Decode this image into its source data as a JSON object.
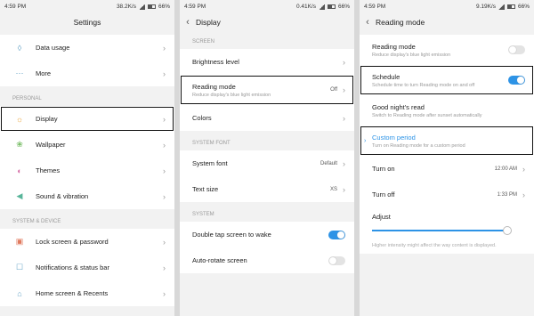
{
  "p1": {
    "time": "4:59 PM",
    "net": "38.2K/s",
    "bat": "66%",
    "title": "Settings",
    "rows_a": [
      {
        "icon": "◊",
        "label": "Data usage"
      },
      {
        "icon": "⋯",
        "label": "More"
      }
    ],
    "sec1": "PERSONAL",
    "rows_b": [
      {
        "icon": "☼",
        "label": "Display"
      },
      {
        "icon": "❀",
        "label": "Wallpaper"
      },
      {
        "icon": "◐",
        "label": "Themes"
      },
      {
        "icon": "◀",
        "label": "Sound & vibration"
      }
    ],
    "sec2": "SYSTEM & DEVICE",
    "rows_c": [
      {
        "icon": "▣",
        "label": "Lock screen & password"
      },
      {
        "icon": "☐",
        "label": "Notifications & status bar"
      },
      {
        "icon": "⌂",
        "label": "Home screen & Recents"
      }
    ]
  },
  "p2": {
    "time": "4:59 PM",
    "net": "0.41K/s",
    "bat": "66%",
    "title": "Display",
    "sec1": "SCREEN",
    "brightness": "Brightness level",
    "reading": "Reading mode",
    "reading_sub": "Reduce display's blue light emission",
    "reading_val": "Off",
    "colors": "Colors",
    "sec2": "SYSTEM FONT",
    "font": "System font",
    "font_val": "Default",
    "text": "Text size",
    "text_val": "XS",
    "sec3": "SYSTEM",
    "dtap": "Double tap screen to wake",
    "rotate": "Auto-rotate screen"
  },
  "p3": {
    "time": "4:59 PM",
    "net": "9.19K/s",
    "bat": "66%",
    "title": "Reading mode",
    "rm": "Reading mode",
    "rm_sub": "Reduce display's blue light emission",
    "sched": "Schedule",
    "sched_sub": "Schedule time to turn Reading mode on and off",
    "gn": "Good night's read",
    "gn_sub": "Switch to Reading mode after sunset automatically",
    "cp": "Custom period",
    "cp_sub": "Turn on Reading mode for a custom period",
    "on": "Turn on",
    "on_val": "12:00 AM",
    "off": "Turn off",
    "off_val": "1:33 PM",
    "adj": "Adjust",
    "foot": "Higher intensity might affect the way content is displayed.",
    "adjust_level": 0.95
  }
}
